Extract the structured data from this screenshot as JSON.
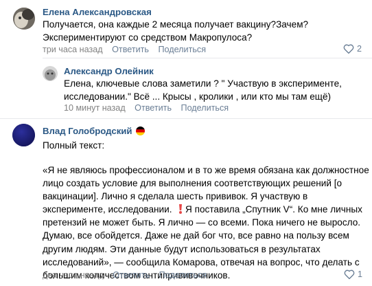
{
  "comment1": {
    "author": "Елена Александровская",
    "lines": [
      "Получается, она каждые 2 месяца получает вакцину?Зачем?",
      "Экспериментируют со средством Макропулоса?"
    ],
    "time": "три часа назад",
    "reply": "Ответить",
    "share": "Поделиться",
    "likes": "2"
  },
  "reply1": {
    "author": "Александр Олейник",
    "lines": [
      "Елена, ключевые слова заметили ? \" Участвую в эксперименте,",
      "исследовании.\" Всё ... Крысы , кролики , или кто мы там ещё)"
    ],
    "time": "10 минут назад",
    "reply": "Ответить",
    "share": "Поделиться"
  },
  "comment2": {
    "author": "Влад Голобродский",
    "flag": "germany-flag-icon",
    "intro": "Полный текст:",
    "lines": [
      "«Я не являюсь профессионалом и в то же время обязана как должностное",
      "лицо создать условие для выполнения соответствующих решений [о",
      "вакцинации]. Лично я сделала шесть прививок. Я участвую в",
      "эксперименте, исследовании.",
      " Я поставила „Спутник V“. Ко мне личных",
      "претензий не может быть. Я лично — со всеми. Пока ничего не выросло.",
      "Думаю, все обойдется. Даже не дай бог что, все равно на пользу всем",
      "другим людям. Эти данные будут использоваться в результатах",
      "исследований», — сообщила Комарова, отвечая на вопрос, что делать с",
      "большим количеством антипрививочников."
    ],
    "time": "два часа назад",
    "reply": "Ответить",
    "share": "Поделиться",
    "likes": "1"
  },
  "colors": {
    "link": "#2a5885",
    "meta": "#828282",
    "accent": "#6a7e95",
    "exclamation": "#e64646"
  }
}
